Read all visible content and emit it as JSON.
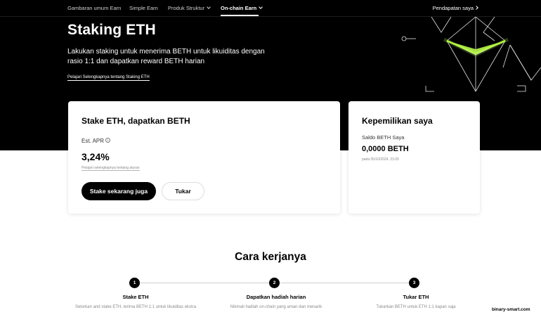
{
  "nav": {
    "items": [
      "Gambaran umum Earn",
      "Simple Earn",
      "Produk Struktur",
      "On-chain Earn"
    ],
    "right_link": "Pendapatan saya"
  },
  "hero": {
    "title": "Staking ETH",
    "description": "Lakukan staking untuk menerima BETH untuk likuiditas dengan rasio 1:1 dan dapatkan reward BETH harian",
    "learn_more": "Pelajari Selengkapnya tentang Staking ETH",
    "accent_color": "#b7f64a"
  },
  "stake_card": {
    "title": "Stake ETH, dapatkan BETH",
    "apr_label": "Est. APR",
    "apr_value": "3,24%",
    "rules_link": "Pelajari selengkapnya tentang aturan",
    "primary_button": "Stake sekarang juga",
    "secondary_button": "Tukar"
  },
  "holdings_card": {
    "title": "Kepemilikan saya",
    "balance_label": "Saldo BETH Saya",
    "balance_value": "0,0000 BETH",
    "timestamp": "pada 05/10/2024, 23.05"
  },
  "how_it_works": {
    "title": "Cara kerjanya",
    "steps": [
      {
        "num": "1",
        "title": "Stake ETH",
        "desc": "Setorkan and stake ETH, terima BETH 1:1 untuk likuiditas ekstra"
      },
      {
        "num": "2",
        "title": "Dapatkan hadiah harian",
        "desc": "Nikmati hadiah on-chain yang aman dan menarik"
      },
      {
        "num": "3",
        "title": "Tukar ETH",
        "desc": "Tukarkan BETH untuk ETH 1:1 kapan saja"
      }
    ]
  },
  "watermark": "binary-smart.com"
}
